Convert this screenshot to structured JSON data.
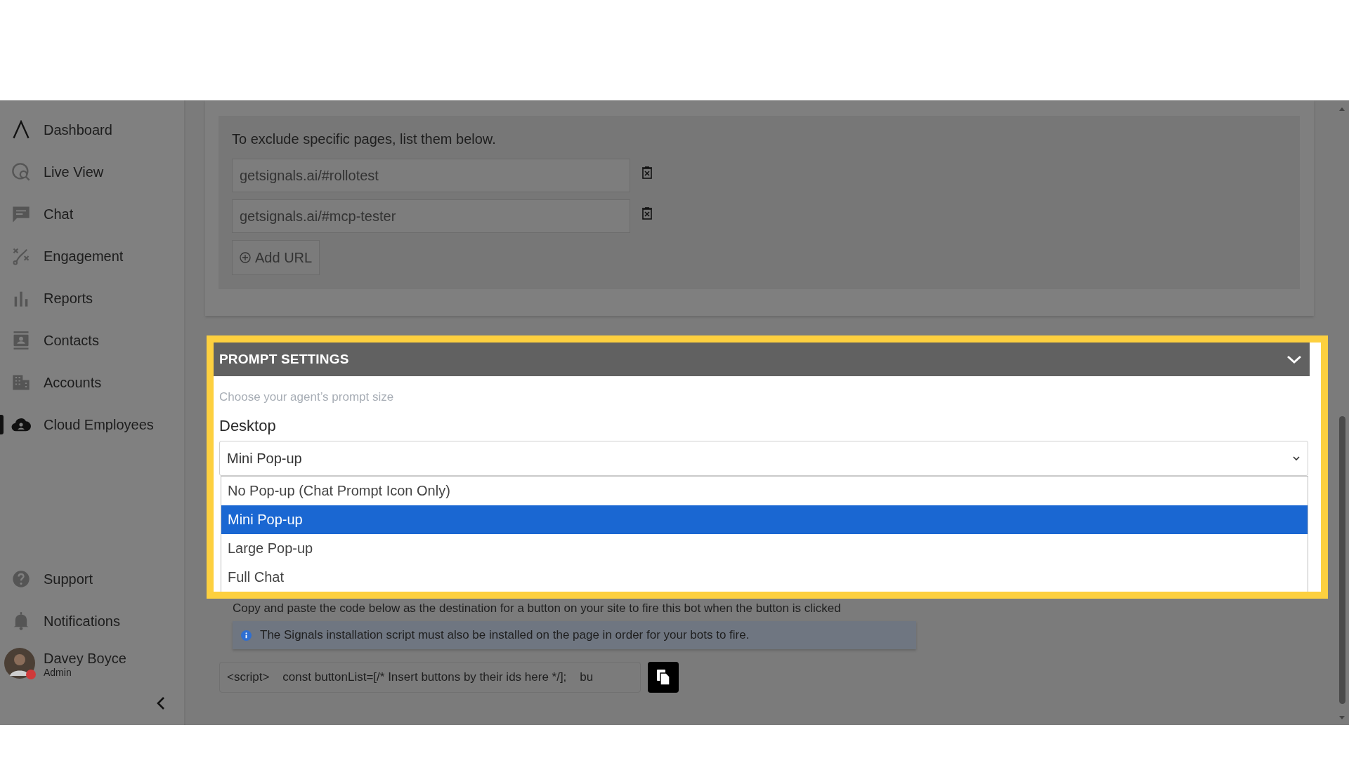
{
  "sidebar": {
    "items": [
      {
        "label": "Dashboard",
        "selected": false
      },
      {
        "label": "Live View",
        "selected": false
      },
      {
        "label": "Chat",
        "selected": false
      },
      {
        "label": "Engagement",
        "selected": false
      },
      {
        "label": "Reports",
        "selected": false
      },
      {
        "label": "Contacts",
        "selected": false
      },
      {
        "label": "Accounts",
        "selected": false
      },
      {
        "label": "Cloud Employees",
        "selected": true
      }
    ],
    "bottom_items": [
      {
        "label": "Support"
      },
      {
        "label": "Notifications"
      }
    ],
    "user": {
      "name": "Davey Boyce",
      "role": "Admin"
    }
  },
  "exclude_card": {
    "instruction": "To exclude specific pages, list them below.",
    "urls": [
      "getsignals.ai/#rollotest",
      "getsignals.ai/#mcp-tester"
    ],
    "add_button": "Add URL"
  },
  "prompt_settings": {
    "title": "PROMPT SETTINGS",
    "expanded": true,
    "hint": "Choose your agent’s prompt size",
    "field_label": "Desktop",
    "value": "Mini Pop-up",
    "options": [
      {
        "label": "No Pop-up (Chat Prompt Icon Only)",
        "selected": false
      },
      {
        "label": "Mini Pop-up",
        "selected": true
      },
      {
        "label": "Large Pop-up",
        "selected": false
      },
      {
        "label": "Full Chat",
        "selected": false
      }
    ]
  },
  "button_trigger": {
    "instruction": "Copy and paste the code below as the destination for a button on your site to fire this bot when the button is clicked",
    "notice": "The Signals installation script must also be installed on the page in order for your bots to fire.",
    "code": "<script>    const buttonList=[/* Insert buttons by their ids here */];    bu"
  }
}
